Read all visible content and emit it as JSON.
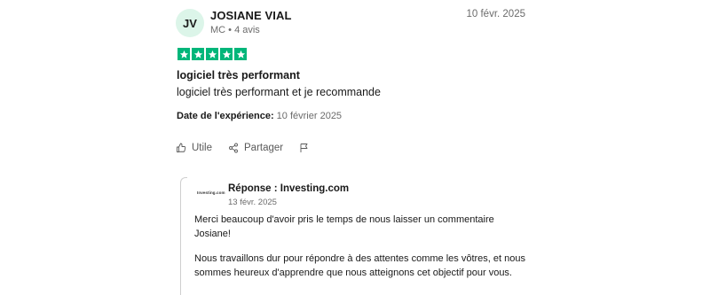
{
  "review": {
    "avatar_initials": "JV",
    "author": "JOSIANE VIAL",
    "meta": "MC • 4 avis",
    "date": "10 févr. 2025",
    "rating": 5,
    "star_color": "#00b67a",
    "title": "logiciel très performant",
    "body": "logiciel très performant et je recommande",
    "experience_label": "Date de l'expérience:",
    "experience_value": "10 février 2025"
  },
  "actions": {
    "useful_label": "Utile",
    "share_label": "Partager",
    "useful_icon": "thumbs-up-icon",
    "share_icon": "share-icon",
    "flag_icon": "flag-icon"
  },
  "reply": {
    "logo_text": "Investing.com",
    "title": "Réponse : Investing.com",
    "date": "13 févr. 2025",
    "paragraph1": "Merci beaucoup d'avoir pris le temps de nous laisser un commentaire Josiane!",
    "paragraph2": "Nous travaillons dur pour répondre à des attentes comme les vôtres, et nous sommes heureux d'apprendre que nous atteignons cet objectif pour vous."
  }
}
